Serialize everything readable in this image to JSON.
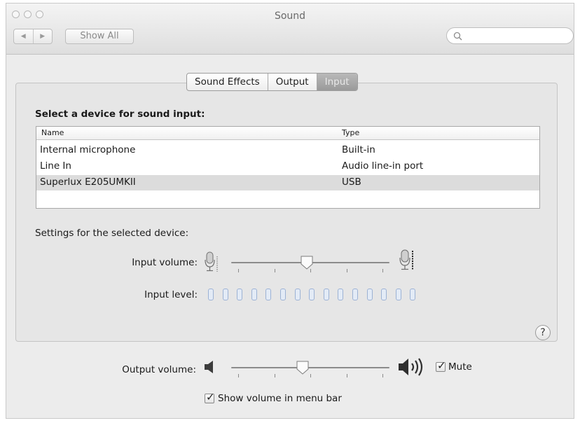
{
  "window": {
    "title": "Sound"
  },
  "toolbar": {
    "back_glyph": "◀",
    "forward_glyph": "▶",
    "show_all_label": "Show All",
    "search_placeholder": ""
  },
  "tabs": [
    {
      "label": "Sound Effects",
      "active": false
    },
    {
      "label": "Output",
      "active": false
    },
    {
      "label": "Input",
      "active": true
    }
  ],
  "input_panel": {
    "section_title": "Select a device for sound input:",
    "table": {
      "columns": [
        "Name",
        "Type"
      ],
      "rows": [
        {
          "name": "Internal microphone",
          "type": "Built-in",
          "selected": false
        },
        {
          "name": "Line In",
          "type": "Audio line-in port",
          "selected": false
        },
        {
          "name": "Superlux E205UMKII",
          "type": "USB",
          "selected": true
        }
      ]
    },
    "settings_label": "Settings for the selected device:",
    "input_volume_label": "Input volume:",
    "input_volume": 0.48,
    "input_level_label": "Input level:",
    "input_level_segments": 15,
    "input_level_active": 0
  },
  "help_label": "?",
  "output": {
    "volume_label": "Output volume:",
    "volume": 0.45,
    "mute_label": "Mute",
    "mute_checked": true,
    "show_volume_label": "Show volume in menu bar",
    "show_volume_checked": true
  },
  "icons": {
    "speaker_low": "speaker-low-icon",
    "speaker_high": "speaker-high-icon",
    "mic_low": "microphone-low-icon",
    "mic_high": "microphone-high-icon",
    "search": "search-icon",
    "help": "help-icon"
  },
  "colors": {
    "selected_tab": "#a9a9a9",
    "level_segment": "#9cb2d4",
    "selected_row": "#dcdcdc"
  }
}
